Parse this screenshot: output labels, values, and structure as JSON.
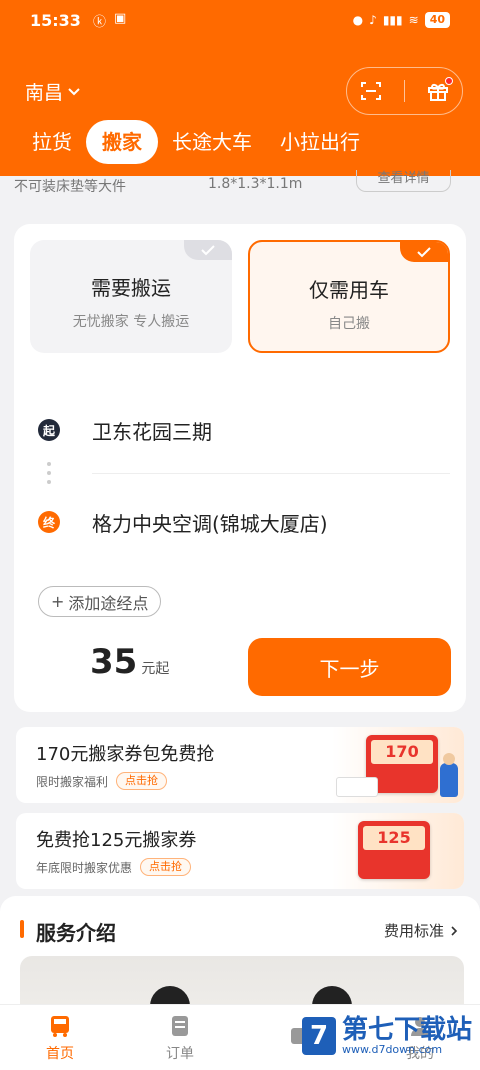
{
  "status": {
    "time": "15:33",
    "battery": "40"
  },
  "header": {
    "city": "南昌",
    "tabs": [
      "拉货",
      "搬家",
      "长途大车",
      "小拉出行"
    ],
    "active_tab": "搬家"
  },
  "peek": {
    "text1": "不可装床垫等大件",
    "text2": "1.8*1.3*1.1m",
    "text3": "查看详情"
  },
  "mode_options": [
    {
      "title": "需要搬运",
      "subtitle": "无忧搬家 专人搬运",
      "selected": false
    },
    {
      "title": "仅需用车",
      "subtitle": "自己搬",
      "selected": true
    }
  ],
  "route": {
    "start_label": "起",
    "start": "卫东花园三期",
    "end_label": "终",
    "end": "格力中央空调(锦城大厦店)",
    "add_waypoint": "添加途经点"
  },
  "price": {
    "amount": "35",
    "unit": "元起"
  },
  "next_button": "下一步",
  "promos": [
    {
      "title": "170元搬家券包免费抢",
      "subtitle": "限时搬家福利",
      "tag": "点击抢",
      "coupon": "170"
    },
    {
      "title": "免费抢125元搬家券",
      "subtitle": "年底限时搬家优惠",
      "tag": "点击抢",
      "coupon": "125"
    }
  ],
  "service": {
    "title": "服务介绍",
    "fee_link": "费用标准"
  },
  "bottom_nav": [
    {
      "label": "首页",
      "active": true
    },
    {
      "label": "订单",
      "active": false
    },
    {
      "label": "",
      "active": false
    },
    {
      "label": "我的",
      "active": false
    }
  ],
  "watermark": {
    "logo": "7",
    "main": "第七下载站",
    "sub": "www.d7down.com"
  },
  "colors": {
    "accent": "#ff6a00",
    "background": "#f2f2f4"
  }
}
